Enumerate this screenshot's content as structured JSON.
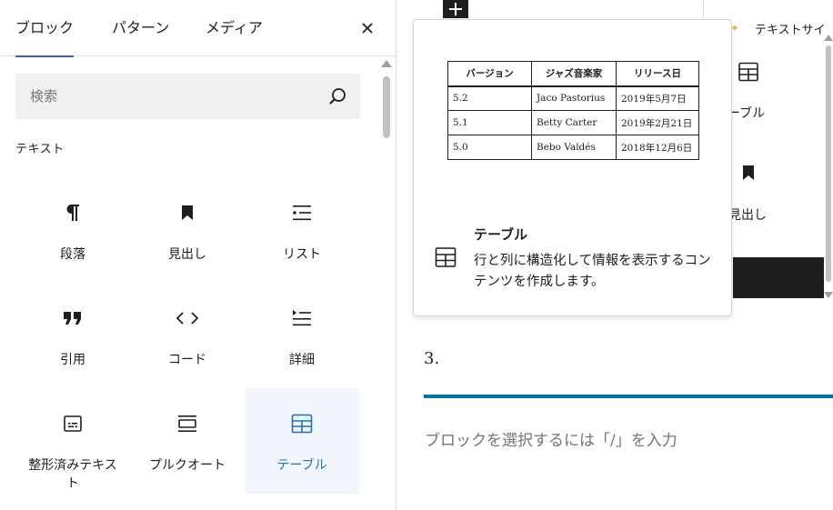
{
  "inserter": {
    "tabs": [
      {
        "label": "ブロック",
        "active": true
      },
      {
        "label": "パターン",
        "active": false
      },
      {
        "label": "メディア",
        "active": false
      }
    ],
    "close_icon": "close-icon",
    "search": {
      "placeholder": "検索",
      "value": "",
      "icon": "search-icon"
    },
    "category": "テキスト",
    "blocks": [
      {
        "label": "段落",
        "icon": "paragraph-icon"
      },
      {
        "label": "見出し",
        "icon": "heading-icon"
      },
      {
        "label": "リスト",
        "icon": "list-icon"
      },
      {
        "label": "引用",
        "icon": "quote-icon"
      },
      {
        "label": "コード",
        "icon": "code-icon"
      },
      {
        "label": "詳細",
        "icon": "details-icon"
      },
      {
        "label": "整形済みテキスト",
        "icon": "preformatted-icon"
      },
      {
        "label": "プルクオート",
        "icon": "pullquote-icon"
      },
      {
        "label": "テーブル",
        "icon": "table-icon",
        "selected": true
      }
    ]
  },
  "preview": {
    "table": {
      "headers": [
        "バージョン",
        "ジャズ音楽家",
        "リリース日"
      ],
      "rows": [
        [
          "5.2",
          "Jaco Pastorius",
          "2019年5月7日"
        ],
        [
          "5.1",
          "Betty Carter",
          "2019年2月21日"
        ],
        [
          "5.0",
          "Bebo Valdés",
          "2018年12月6日"
        ]
      ]
    },
    "title": "テーブル",
    "description": "行と列に構造化して情報を表示するコンテンツを作成します。",
    "icon": "table-icon"
  },
  "canvas": {
    "partial_header": "テキストサイ",
    "partial_items": [
      {
        "label": "ーブル",
        "icon": "table-icon"
      },
      {
        "label": "見出し",
        "icon": "heading-icon"
      }
    ],
    "list_number": "3.",
    "placeholder": "ブロックを選択するには「/」を入力"
  },
  "colors": {
    "accent": "#3858e9",
    "selected_bg": "#f0f6fc",
    "selected_text": "#2271b1",
    "separator": "#0073aa"
  }
}
